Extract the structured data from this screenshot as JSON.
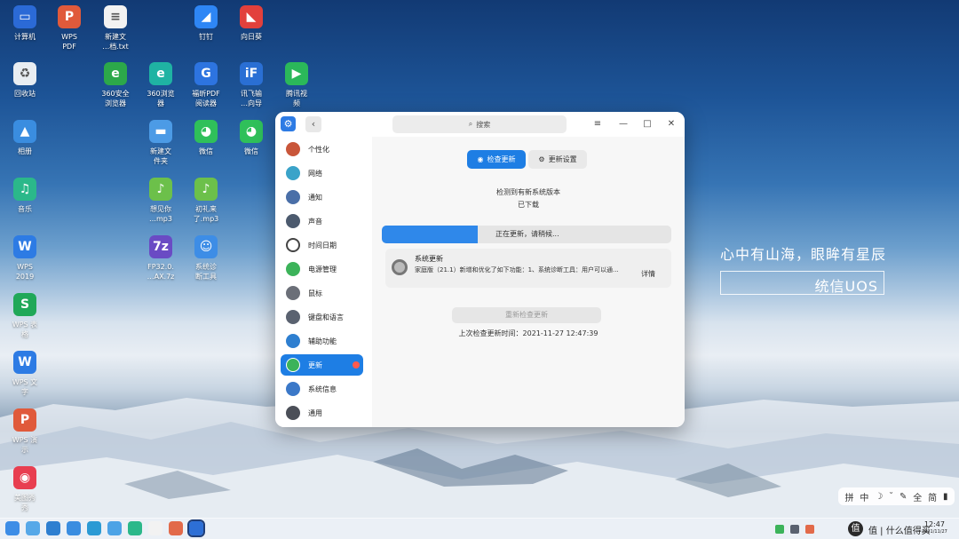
{
  "desktop": {
    "icons": [
      {
        "label": "计算机",
        "glyph": "▭",
        "color": "#2b6ad6"
      },
      {
        "label": "WPS\nPDF",
        "glyph": "P",
        "color": "#e05a3b"
      },
      {
        "label": "新建文\n…档.txt",
        "glyph": "≡",
        "color": "#f2f2f2"
      },
      {
        "label": "钉钉",
        "glyph": "◢",
        "color": "#2e86f5"
      },
      {
        "label": "向日葵",
        "glyph": "◣",
        "color": "#e2403c"
      },
      {
        "label": "回收站",
        "glyph": "♻",
        "color": "#e8edf2"
      },
      {
        "label": "360安全\n浏览器",
        "glyph": "e",
        "color": "#2ca84a"
      },
      {
        "label": "360浏览\n器",
        "glyph": "e",
        "color": "#1fb3a3"
      },
      {
        "label": "福昕PDF\n阅读器",
        "glyph": "G",
        "color": "#2d74e0"
      },
      {
        "label": "讯飞输\n…向导",
        "glyph": "iF",
        "color": "#2a6fd4"
      },
      {
        "label": "腾讯视\n频",
        "glyph": "▶",
        "color": "#2bb85a"
      },
      {
        "label": "相册",
        "glyph": "▲",
        "color": "#3a8de0"
      },
      {
        "label": "新建文\n件夹",
        "glyph": "▬",
        "color": "#4c9be6"
      },
      {
        "label": "微信",
        "glyph": "◕",
        "color": "#2fc05a"
      },
      {
        "label": "微信",
        "glyph": "◕",
        "color": "#2fc05a"
      },
      {
        "label": "音乐",
        "glyph": "♫",
        "color": "#2bb88a"
      },
      {
        "label": "想见你\n…mp3",
        "glyph": "♪",
        "color": "#6cc04a"
      },
      {
        "label": "初礼来\n了.mp3",
        "glyph": "♪",
        "color": "#6cc04a"
      },
      {
        "label": "WPS\n2019",
        "glyph": "W",
        "color": "#2d7be4"
      },
      {
        "label": "FP32.0.\n…AX.7z",
        "glyph": "7z",
        "color": "#6a4bc4"
      },
      {
        "label": "系统诊\n断工具",
        "glyph": "☺",
        "color": "#3d8de6"
      },
      {
        "label": "WPS 表\n格",
        "glyph": "S",
        "color": "#20a858"
      },
      {
        "label": "WPS 文\n字",
        "glyph": "W",
        "color": "#2d7be4"
      },
      {
        "label": "WPS 演\n示",
        "glyph": "P",
        "color": "#e05a3b"
      },
      {
        "label": "美图秀\n秀",
        "glyph": "◉",
        "color": "#e83e50"
      }
    ],
    "slogan": "心中有山海，眼眸有星辰",
    "brand": "统信UOS"
  },
  "window": {
    "search_placeholder": "搜索",
    "back_glyph": "‹",
    "app_glyph": "⚙",
    "controls": {
      "menu": "≡",
      "minimize": "—",
      "maximize": "□",
      "close": "✕"
    },
    "sidebar": [
      {
        "label": "个性化",
        "color": "#c9563a",
        "active": false
      },
      {
        "label": "网络",
        "color": "#3aa3c9",
        "active": false
      },
      {
        "label": "通知",
        "color": "#4a6fa8",
        "active": false
      },
      {
        "label": "声音",
        "color": "#4c5a6e",
        "active": false
      },
      {
        "label": "时间日期",
        "color": "#ffffff",
        "active": false
      },
      {
        "label": "电源管理",
        "color": "#3cb35a",
        "active": false
      },
      {
        "label": "鼠标",
        "color": "#6b6f78",
        "active": false
      },
      {
        "label": "键盘和语言",
        "color": "#5a6270",
        "active": false
      },
      {
        "label": "辅助功能",
        "color": "#2e7fd0",
        "active": false
      },
      {
        "label": "更新",
        "color": "#3cb35a",
        "active": true
      },
      {
        "label": "系统信息",
        "color": "#3b78c8",
        "active": false
      },
      {
        "label": "通用",
        "color": "#4b4f58",
        "active": false
      }
    ],
    "tabs": {
      "check": "检查更新",
      "settings": "更新设置"
    },
    "status_line1": "检测到有新系统版本",
    "status_line2": "已下载",
    "progress": {
      "label": "正在更新，请稍候...",
      "fraction": 0.33
    },
    "update": {
      "title": "系统更新",
      "desc": "家庭版（21.1）新增和优化了如下功能：1、系统诊断工具：用户可以通...",
      "detail": "详情"
    },
    "recheck_button": "重新检查更新",
    "last_check": "上次检查更新时间：2021-11-27 12:47:39"
  },
  "ime_bar": {
    "items": [
      "拼",
      "中",
      "☽",
      "˘",
      "✎",
      "全",
      "简",
      "▮"
    ]
  },
  "taskbar": {
    "apps": [
      {
        "name": "launcher",
        "color": "#3d8de6"
      },
      {
        "name": "multitask",
        "color": "#56a8e8"
      },
      {
        "name": "home",
        "color": "#2e7fd0"
      },
      {
        "name": "file-manager",
        "color": "#3a8de0"
      },
      {
        "name": "browser",
        "color": "#2b9ad4"
      },
      {
        "name": "album",
        "color": "#4ca3e6"
      },
      {
        "name": "music",
        "color": "#2bb88a"
      },
      {
        "name": "calendar",
        "color": "#f2f2f2"
      },
      {
        "name": "mail",
        "color": "#e26a4a"
      },
      {
        "name": "control-center",
        "color": "#2d6fd6"
      }
    ],
    "time": "12:47",
    "date": "2021/11/27"
  },
  "watermark": "值 | 什么值得买"
}
